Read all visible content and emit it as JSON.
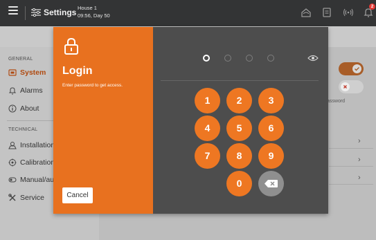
{
  "topbar": {
    "title": "Settings",
    "house_name": "House 1",
    "house_sub": "09:56, Day 50",
    "notification_count": "2"
  },
  "sidebar": {
    "general_label": "GENERAL",
    "technical_label": "TECHNICAL",
    "items": [
      {
        "label": "System",
        "icon": "system-icon",
        "active": true
      },
      {
        "label": "Alarms",
        "icon": "bell-icon"
      },
      {
        "label": "About",
        "icon": "info-icon"
      },
      {
        "label": "Installation",
        "icon": "installation-icon"
      },
      {
        "label": "Calibration",
        "icon": "calibration-icon"
      },
      {
        "label": "Manual/au",
        "icon": "manual-icon"
      },
      {
        "label": "Service",
        "icon": "tools-icon"
      }
    ]
  },
  "content": {
    "password_note": "assword",
    "toggle_states": [
      true,
      false
    ]
  },
  "login": {
    "title": "Login",
    "subtitle": "Enter password to get access.",
    "cancel_label": "Cancel",
    "pin_length": 4,
    "pin_filled": 0,
    "keys": [
      "1",
      "2",
      "3",
      "4",
      "5",
      "6",
      "7",
      "8",
      "9",
      "0"
    ]
  },
  "colors": {
    "accent": "#ee7722",
    "dialog_left": "#e8711f",
    "dialog_right": "#4d4d4d",
    "topbar": "#333435",
    "backspace_key": "#8f8f8f"
  }
}
